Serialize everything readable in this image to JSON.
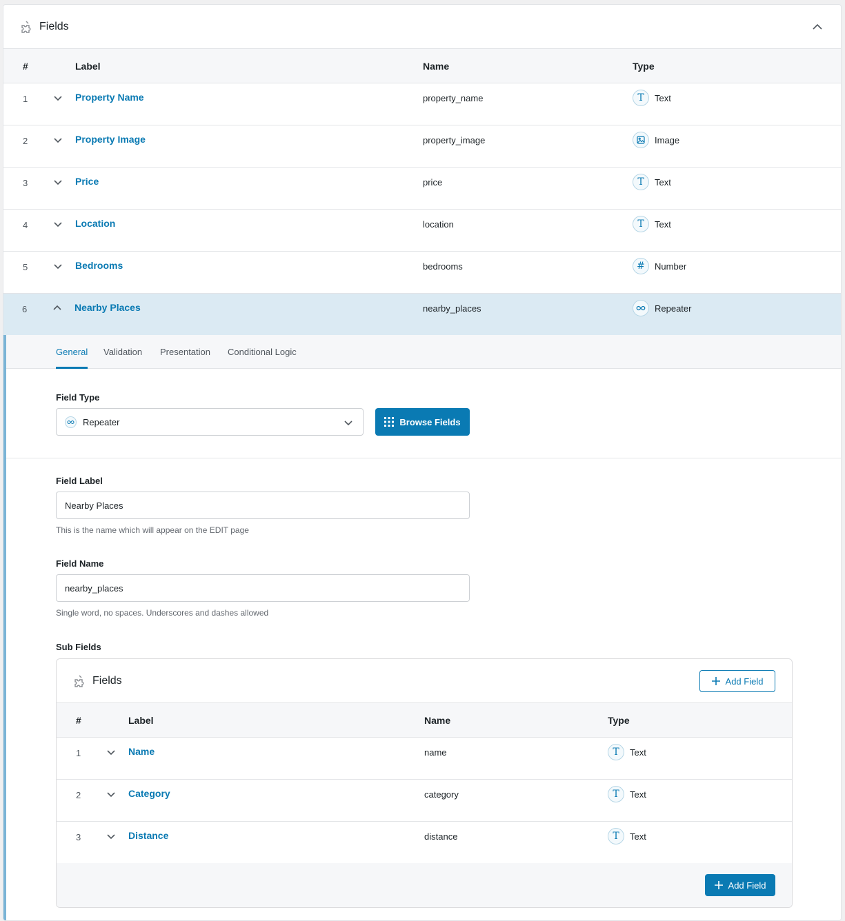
{
  "panel": {
    "title": "Fields",
    "icon": "puzzle-icon"
  },
  "columns": {
    "num": "#",
    "label": "Label",
    "name": "Name",
    "type": "Type"
  },
  "fields": [
    {
      "num": "1",
      "label": "Property Name",
      "name": "property_name",
      "type": "Text",
      "icon": "T"
    },
    {
      "num": "2",
      "label": "Property Image",
      "name": "property_image",
      "type": "Image",
      "icon": "image"
    },
    {
      "num": "3",
      "label": "Price",
      "name": "price",
      "type": "Text",
      "icon": "T"
    },
    {
      "num": "4",
      "label": "Location",
      "name": "location",
      "type": "Text",
      "icon": "T"
    },
    {
      "num": "5",
      "label": "Bedrooms",
      "name": "bedrooms",
      "type": "Number",
      "icon": "#"
    },
    {
      "num": "6",
      "label": "Nearby Places",
      "name": "nearby_places",
      "type": "Repeater",
      "icon": "infinity"
    }
  ],
  "editor": {
    "tabs": [
      "General",
      "Validation",
      "Presentation",
      "Conditional Logic"
    ],
    "active_tab": "General",
    "field_type_label": "Field Type",
    "field_type_value": "Repeater",
    "browse_button": "Browse Fields",
    "field_label_label": "Field Label",
    "field_label_value": "Nearby Places",
    "field_label_hint": "This is the name which will appear on the EDIT page",
    "field_name_label": "Field Name",
    "field_name_value": "nearby_places",
    "field_name_hint": "Single word, no spaces. Underscores and dashes allowed",
    "sub_fields_label": "Sub Fields"
  },
  "sub_fields": {
    "title": "Fields",
    "add_button": "Add Field",
    "rows": [
      {
        "num": "1",
        "label": "Name",
        "name": "name",
        "type": "Text"
      },
      {
        "num": "2",
        "label": "Category",
        "name": "category",
        "type": "Text"
      },
      {
        "num": "3",
        "label": "Distance",
        "name": "distance",
        "type": "Text"
      }
    ]
  },
  "colors": {
    "accent": "#0a7ab3",
    "active_row": "#dbeaf3",
    "active_border": "#7ab4d6"
  }
}
